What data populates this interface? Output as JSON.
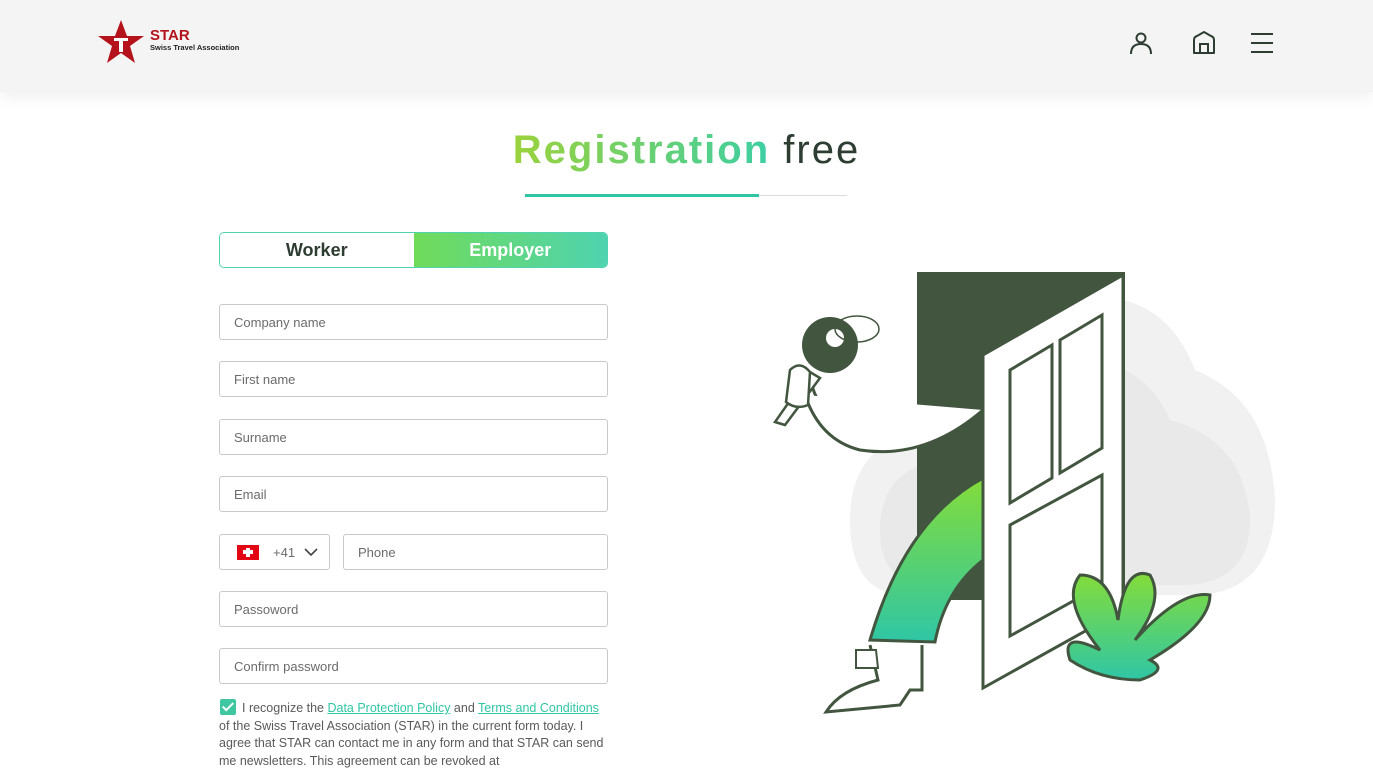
{
  "header": {
    "logo_title": "STAR",
    "logo_subtitle": "Swiss Travel Association",
    "icons": [
      "user-icon",
      "home-icon",
      "menu-icon"
    ]
  },
  "page": {
    "title_strong": "Registration",
    "title_rest": "free"
  },
  "toggle": {
    "worker": "Worker",
    "employer": "Employer",
    "active": "Employer"
  },
  "form": {
    "company_placeholder": "Company name",
    "first_name_placeholder": "First name",
    "surname_placeholder": "Surname",
    "email_placeholder": "Email",
    "country_code": "+41",
    "phone_placeholder": "Phone",
    "password_placeholder": "Passoword",
    "confirm_password_placeholder": "Confirm password"
  },
  "consent": {
    "checked": true,
    "text_1": "I recognize the ",
    "link_policy": "Data Protection Policy",
    "text_2": " and ",
    "link_terms": "Terms and Conditions ",
    "text_3": "of the Swiss Travel Association (STAR) in the current form today. I agree that STAR can contact me in any form and that STAR can send me newsletters. This agreement can be revoked at"
  },
  "colors": {
    "accent": "#2fc6a5",
    "brand_red": "#b4131c",
    "dark_green": "#42563f",
    "gradient_start": "#9bd23c",
    "gradient_end": "#3dcfa3"
  }
}
